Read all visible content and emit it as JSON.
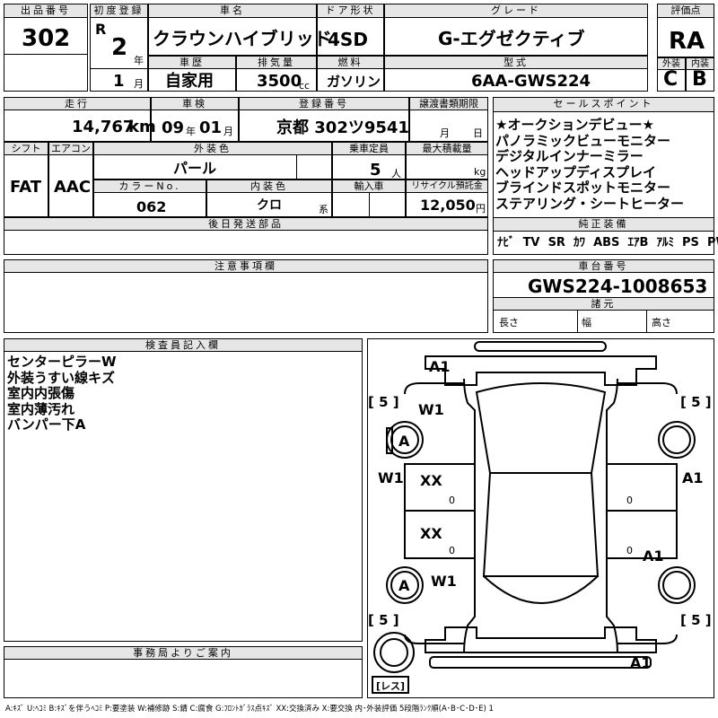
{
  "headers": {
    "lot_no": "出品番号",
    "first_reg": "初度登録",
    "car_name": "車名",
    "door": "ドア形状",
    "grade": "グレード",
    "score": "評価点",
    "history": "車歴",
    "displacement": "排気量",
    "fuel": "燃料",
    "model": "型式",
    "exterior": "外装",
    "interior": "内装",
    "mileage": "走行",
    "inspection": "車検",
    "reg_no": "登録番号",
    "transfer": "譲渡書類期限",
    "sales_points": "セールスポイント",
    "shift": "シフト",
    "ac": "エアコン",
    "ext_color": "外装色",
    "capacity": "乗車定員",
    "max_load": "最大積載量",
    "color_no": "カラーNo.",
    "int_color": "内装色",
    "import": "輸入車",
    "recycle": "リサイクル預託金",
    "later_parts": "後日発送部品",
    "equipment": "純正装備",
    "notes": "注意事項欄",
    "chassis": "車台番号",
    "dimensions": "諸元",
    "inspector": "検査員記入欄",
    "office": "事務局よりご案内"
  },
  "values": {
    "lot_no": "302",
    "era": "R",
    "year": "2",
    "year_unit": "年",
    "month": "1",
    "month_unit": "月",
    "car_name": "クラウンハイブリッド",
    "door": "4SD",
    "grade": "G-エグゼクティブ",
    "score": "RA",
    "history": "自家用",
    "displacement": "3500",
    "displacement_unit": "cc",
    "fuel": "ガソリン",
    "model": "6AA-GWS224",
    "exterior": "C",
    "interior": "B",
    "mileage": "14,767",
    "mileage_unit": "km",
    "insp_year": "09",
    "insp_year_unit": "年",
    "insp_month": "01",
    "insp_month_unit": "月",
    "reg_no": "京都 302ツ9541",
    "transfer_month_unit": "月",
    "transfer_day_unit": "日",
    "shift": "FAT",
    "ac": "AAC",
    "ext_color": "パール",
    "capacity": "5",
    "capacity_unit": "人",
    "max_load_unit": "kg",
    "color_no": "062",
    "int_color": "クロ",
    "int_color_unit": "系",
    "recycle": "12,050",
    "recycle_unit": "円",
    "chassis": "GWS224-1008653",
    "length_label": "長さ",
    "width_label": "幅",
    "height_label": "高さ",
    "rest_label": "レス"
  },
  "sales_points": [
    "★オークションデビュー★",
    "パノラミックビューモニター",
    "デジタルインナーミラー",
    "ヘッドアップディスプレイ",
    "ブラインドスポットモニター",
    "ステアリング・シートヒーター"
  ],
  "equipment": [
    "ﾅﾋﾞ",
    "TV",
    "SR",
    "ｶﾜ",
    "ABS",
    "ｴｱB",
    "ｱﾙﾐ",
    "PS",
    "PW"
  ],
  "inspector_notes": [
    "センターピラーW",
    "外装うすい線キズ",
    "室内内張傷",
    "室内薄汚れ",
    "バンパー下A"
  ],
  "diagram_marks": {
    "front_top": "A1",
    "tire_fl_depth": "[ 5 ]",
    "tire_fr_depth": "[ 5 ]",
    "tire_rl_depth": "[ 5 ]",
    "tire_rr_depth": "[ 5 ]",
    "fl_fender": "W1",
    "fl_wheel": "A",
    "rl_wheel": "A",
    "rl_fender": "W1",
    "left_front_door": "W1",
    "right_front_door": "A1",
    "right_rear_door": "A1",
    "roof_front": "XX",
    "roof_rear": "XX",
    "rear_bottom": "A1",
    "zero1": "0",
    "zero2": "0",
    "zero3": "0",
    "zero4": "0"
  },
  "legend": "A:ｷｽﾞ U:ﾍｺﾐ B:ｷｽﾞを伴うﾍｺﾐ P:要塗装 W:補修跡 S:錆 C:腐食 G:ﾌﾛﾝﾄｶﾞﾗｽ点ｷｽﾞ XX:交換済み X:要交換 内･外装評価 5段階ﾗﾝｸ順(A･B･C･D･E) 1"
}
